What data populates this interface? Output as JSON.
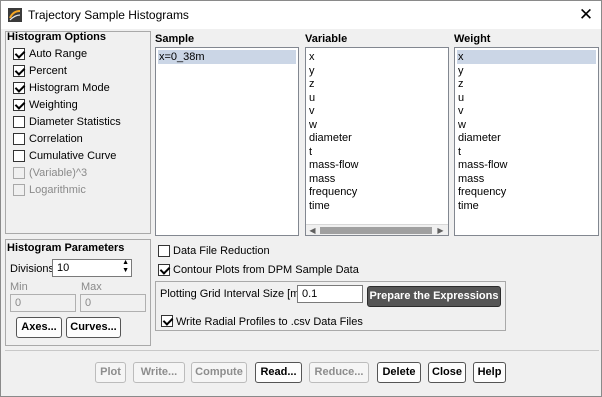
{
  "window": {
    "title": "Trajectory Sample Histograms"
  },
  "histogram_options": {
    "title": "Histogram Options",
    "items": [
      {
        "label": "Auto Range",
        "checked": true,
        "enabled": true
      },
      {
        "label": "Percent",
        "checked": true,
        "enabled": true
      },
      {
        "label": "Histogram Mode",
        "checked": true,
        "enabled": true
      },
      {
        "label": "Weighting",
        "checked": true,
        "enabled": true
      },
      {
        "label": "Diameter Statistics",
        "checked": false,
        "enabled": true
      },
      {
        "label": "Correlation",
        "checked": false,
        "enabled": true
      },
      {
        "label": "Cumulative Curve",
        "checked": false,
        "enabled": true
      },
      {
        "label": "(Variable)^3",
        "checked": false,
        "enabled": false
      },
      {
        "label": "Logarithmic",
        "checked": false,
        "enabled": false
      }
    ]
  },
  "sample": {
    "title": "Sample",
    "items": [
      "x=0_38m"
    ],
    "selected": "x=0_38m"
  },
  "variable": {
    "title": "Variable",
    "items": [
      "x",
      "y",
      "z",
      "u",
      "v",
      "w",
      "diameter",
      "t",
      "mass-flow",
      "mass",
      "frequency",
      "time"
    ]
  },
  "weight": {
    "title": "Weight",
    "items": [
      "x",
      "y",
      "z",
      "u",
      "v",
      "w",
      "diameter",
      "t",
      "mass-flow",
      "mass",
      "frequency",
      "time"
    ],
    "selected": "x"
  },
  "histogram_parameters": {
    "title": "Histogram Parameters",
    "divisions_label": "Divisions",
    "divisions_value": "10",
    "min_label": "Min",
    "min_value": "0",
    "max_label": "Max",
    "max_value": "0",
    "axes_label": "Axes...",
    "curves_label": "Curves..."
  },
  "options": {
    "data_file_reduction": {
      "label": "Data File Reduction",
      "checked": false
    },
    "contour_plots": {
      "label": "Contour Plots from DPM Sample Data",
      "checked": true
    },
    "grid_interval_label": "Plotting Grid Interval Size [m]",
    "grid_interval_value": "0.1",
    "prepare_label": "Prepare the Expressions",
    "write_radial": {
      "label": "Write Radial Profiles to .csv Data Files",
      "checked": true
    }
  },
  "buttons": {
    "plot": "Plot",
    "write": "Write...",
    "compute": "Compute",
    "read": "Read...",
    "reduce": "Reduce...",
    "delete": "Delete",
    "close": "Close",
    "help": "Help"
  },
  "icons": {
    "app": "fluent-app-icon",
    "close": "close-icon"
  }
}
